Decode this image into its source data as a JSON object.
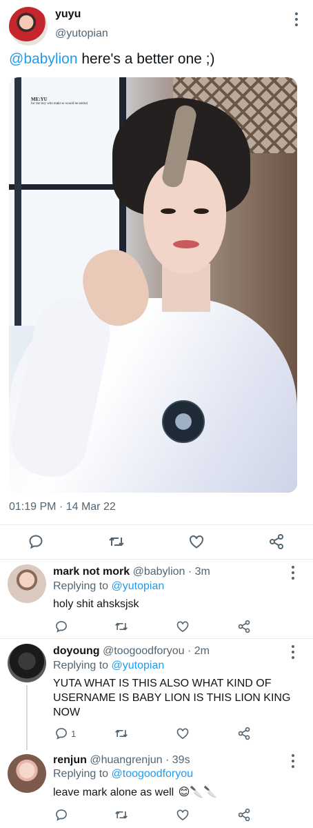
{
  "main_tweet": {
    "display_name": "yuyu",
    "handle": "@yutopian",
    "mention": "@babylion",
    "text": " here's a better one ;)",
    "media": {
      "caption_title": "ME:YU",
      "caption_sub": "for the boy who makt se would be:entitel"
    },
    "timestamp": "01:19 PM · 14 Mar 22"
  },
  "replies": [
    {
      "display_name": "mark not mork",
      "meta": " @babylion · 3m",
      "replying_prefix": "Replying to ",
      "replying_to": "@yutopian",
      "text": "holy shit ahsksjsk",
      "reply_count": ""
    },
    {
      "display_name": "doyoung",
      "meta": " @toogoodforyou · 2m",
      "replying_prefix": "Replying to ",
      "replying_to": "@yutopian",
      "text": "YUTA WHAT IS THIS ALSO WHAT KIND OF USERNAME IS BABY LION IS THIS LION KING NOW",
      "reply_count": "1"
    },
    {
      "display_name": "renjun",
      "meta": " @huangrenjun · 39s",
      "replying_prefix": "Replying to ",
      "replying_to": "@toogoodforyou",
      "text": "leave mark alone as well",
      "emojis": "😊🔪🔪",
      "reply_count": ""
    }
  ],
  "icons": [
    "more-icon",
    "reply-icon",
    "retweet-icon",
    "like-icon",
    "share-icon",
    "smiling-face-emoji",
    "knife-emoji"
  ],
  "colors": {
    "link": "#1d9bf0",
    "secondary_text": "#536471",
    "divider": "#e6ecf0"
  }
}
